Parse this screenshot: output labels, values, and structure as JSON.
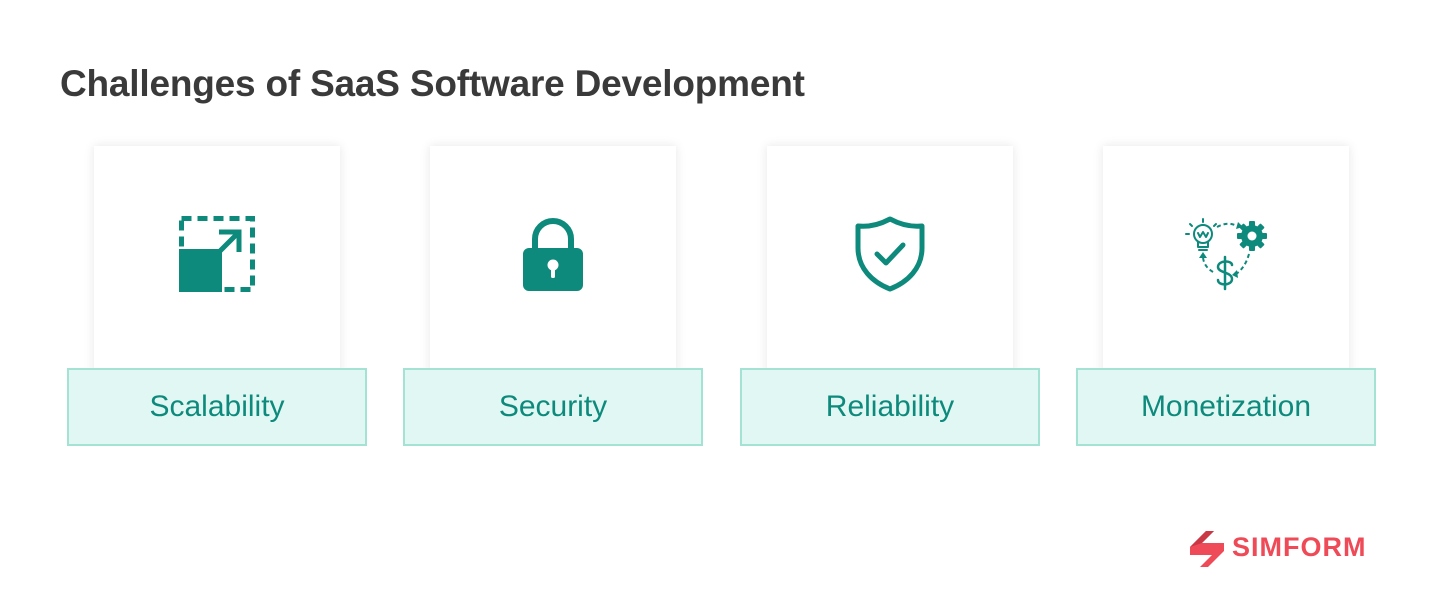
{
  "title": "Challenges of SaaS Software Development",
  "colors": {
    "accent": "#0e8a7c",
    "label_background": "#e0f7f4",
    "label_border": "#a4e2d4",
    "title_text": "#3a3a3a",
    "brand": "#ef4a57"
  },
  "cards": [
    {
      "label": "Scalability",
      "icon": "resize-expand-icon"
    },
    {
      "label": "Security",
      "icon": "padlock-icon"
    },
    {
      "label": "Reliability",
      "icon": "shield-check-icon"
    },
    {
      "label": "Monetization",
      "icon": "idea-gear-dollar-cycle-icon"
    }
  ],
  "brand": {
    "name": "SIMFORM",
    "icon": "simform-logo-icon"
  }
}
